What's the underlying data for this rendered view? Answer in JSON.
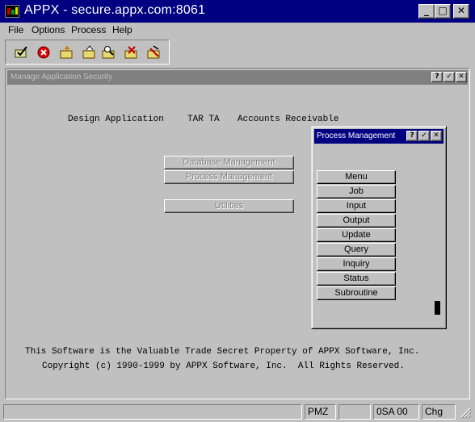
{
  "window": {
    "title": "APPX - secure.appx.com:8061",
    "minimize_glyph": "_",
    "maximize_glyph": "□",
    "close_glyph": "✕"
  },
  "menubar": {
    "items": [
      {
        "label": "File",
        "icon": null
      },
      {
        "label": "Options",
        "icon": null
      },
      {
        "label": "Process",
        "icon": null
      },
      {
        "label": "Help",
        "icon": null
      }
    ]
  },
  "toolbar": {
    "tools": [
      {
        "name": "ok-icon"
      },
      {
        "name": "cancel-icon"
      },
      {
        "name": "add-icon"
      },
      {
        "name": "change-icon"
      },
      {
        "name": "inquire-icon"
      },
      {
        "name": "delete-icon"
      },
      {
        "name": "cancel-folder-icon"
      }
    ]
  },
  "child_window": {
    "title": "Manage Application Security",
    "help_glyph": "?",
    "ok_glyph": "✓",
    "close_glyph": "✕"
  },
  "header_line": {
    "label": "Design Application",
    "code": "TAR TA",
    "name": "Accounts Receivable"
  },
  "main_buttons": [
    {
      "label": "Database Management"
    },
    {
      "label": "Process Management"
    },
    {
      "label": "Utilities"
    }
  ],
  "popup": {
    "title": "Process Management",
    "help_glyph": "?",
    "ok_glyph": "✓",
    "close_glyph": "✕",
    "items": [
      {
        "label": "Menu"
      },
      {
        "label": "Job"
      },
      {
        "label": "Input"
      },
      {
        "label": "Output"
      },
      {
        "label": "Update"
      },
      {
        "label": "Query"
      },
      {
        "label": "Inquiry"
      },
      {
        "label": "Status"
      },
      {
        "label": "Subroutine"
      }
    ]
  },
  "footer": {
    "line1": "This Software is the Valuable Trade Secret Property of APPX Software, Inc.",
    "line2": "Copyright (c) 1990-1999 by APPX Software, Inc.  All Rights Reserved."
  },
  "statusbar": {
    "message": "",
    "cell1": "",
    "user": "PMZ",
    "cell3": "",
    "session": "0SA 00",
    "mode": "Chg"
  },
  "colors": {
    "titlebar": "#000080",
    "face": "#c0c0c0",
    "inactive_title": "#808080"
  }
}
